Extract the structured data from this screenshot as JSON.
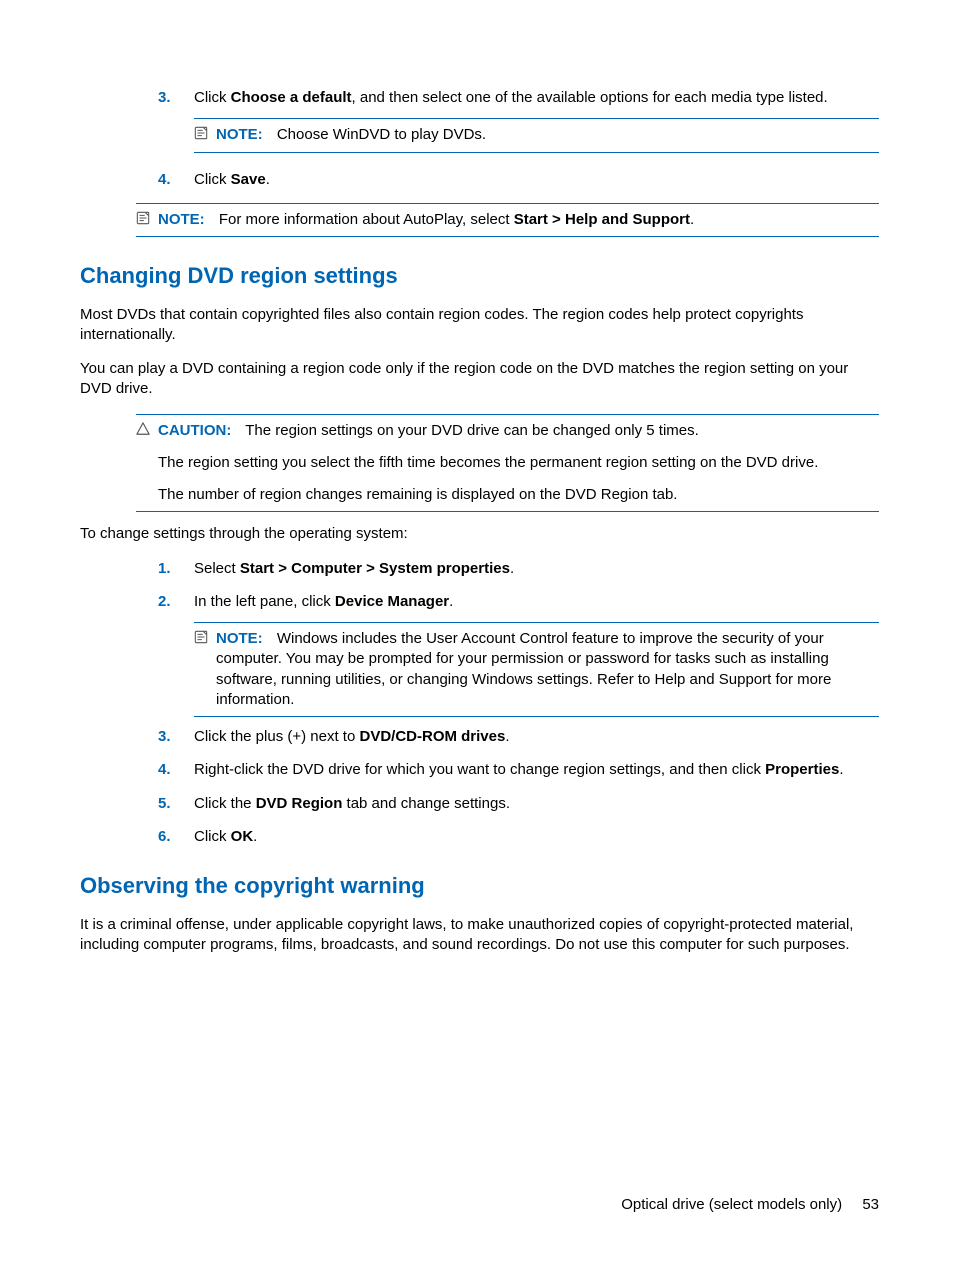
{
  "top": {
    "step3_num": "3.",
    "step3_pre": "Click ",
    "step3_bold": "Choose a default",
    "step3_post": ", and then select one of the available options for each media type listed.",
    "note1_label": "NOTE:",
    "note1_text": "Choose WinDVD to play DVDs.",
    "step4_num": "4.",
    "step4_pre": "Click ",
    "step4_bold": "Save",
    "step4_post": ".",
    "note2_label": "NOTE:",
    "note2_pre": "For more information about AutoPlay, select ",
    "note2_bold": "Start > Help and Support",
    "note2_post": "."
  },
  "section1": {
    "title": "Changing DVD region settings",
    "p1": "Most DVDs that contain copyrighted files also contain region codes. The region codes help protect copyrights internationally.",
    "p2": "You can play a DVD containing a region code only if the region code on the DVD matches the region setting on your DVD drive.",
    "caution_label": "CAUTION:",
    "caution_l1": "The region settings on your DVD drive can be changed only 5 times.",
    "caution_l2": "The region setting you select the fifth time becomes the permanent region setting on the DVD drive.",
    "caution_l3": "The number of region changes remaining is displayed on the DVD Region tab.",
    "p3": "To change settings through the operating system:",
    "s1_num": "1.",
    "s1_pre": "Select ",
    "s1_bold": "Start > Computer > System properties",
    "s1_post": ".",
    "s2_num": "2.",
    "s2_pre": "In the left pane, click ",
    "s2_bold": "Device Manager",
    "s2_post": ".",
    "s2_note_label": "NOTE:",
    "s2_note_text": "Windows includes the User Account Control feature to improve the security of your computer. You may be prompted for your permission or password for tasks such as installing software, running utilities, or changing Windows settings. Refer to Help and Support for more information.",
    "s3_num": "3.",
    "s3_pre": "Click the plus (+) next to ",
    "s3_bold": "DVD/CD-ROM drives",
    "s3_post": ".",
    "s4_num": "4.",
    "s4_pre": "Right-click the DVD drive for which you want to change region settings, and then click ",
    "s4_bold": "Properties",
    "s4_post": ".",
    "s5_num": "5.",
    "s5_pre": "Click the ",
    "s5_bold": "DVD Region",
    "s5_post": " tab and change settings.",
    "s6_num": "6.",
    "s6_pre": "Click ",
    "s6_bold": "OK",
    "s6_post": "."
  },
  "section2": {
    "title": "Observing the copyright warning",
    "p1": "It is a criminal offense, under applicable copyright laws, to make unauthorized copies of copyright-protected material, including computer programs, films, broadcasts, and sound recordings. Do not use this computer for such purposes."
  },
  "footer": {
    "text": "Optical drive (select models only)",
    "page": "53"
  }
}
